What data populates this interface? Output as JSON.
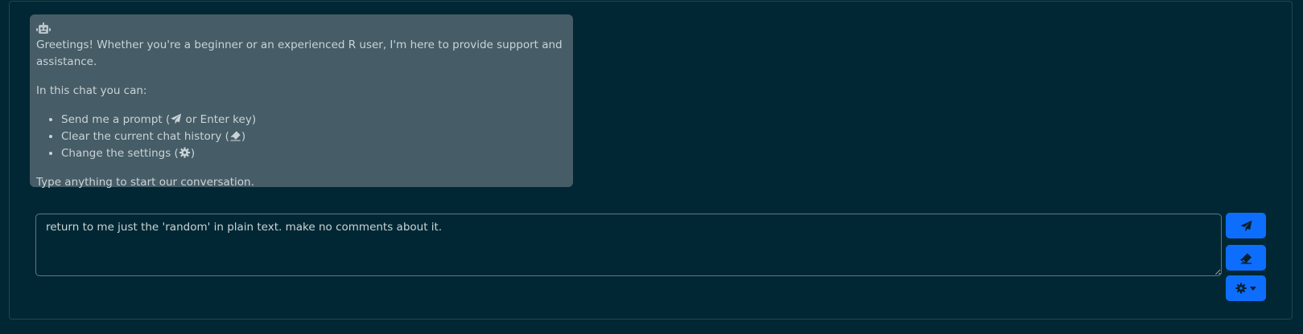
{
  "assistant": {
    "avatar_icon": "robot-icon",
    "greeting": "Greetings! Whether you're a beginner or an experienced R user, I'm here to provide support and assistance.",
    "intro": "In this chat you can:",
    "features": [
      {
        "text_before": "Send me a prompt (",
        "icon": "paper-plane-icon",
        "text_after": " or Enter key)"
      },
      {
        "text_before": "Clear the current chat history (",
        "icon": "eraser-icon",
        "text_after": ")"
      },
      {
        "text_before": "Change the settings (",
        "icon": "gear-icon",
        "text_after": ")"
      }
    ],
    "outro": "Type anything to start our conversation."
  },
  "prompt": {
    "value": "return to me just the 'random' in plain text. make no comments about it."
  },
  "toolbar": {
    "send_icon": "paper-plane-icon",
    "clear_icon": "eraser-icon",
    "settings_icon": "gear-icon",
    "settings_dropdown_icon": "caret-down-icon"
  },
  "colors": {
    "background": "#002733",
    "message_bubble": "#465c66",
    "text": "#c9d4d8",
    "button_primary": "#0d6efd",
    "icon_dark": "#0b1f29"
  }
}
